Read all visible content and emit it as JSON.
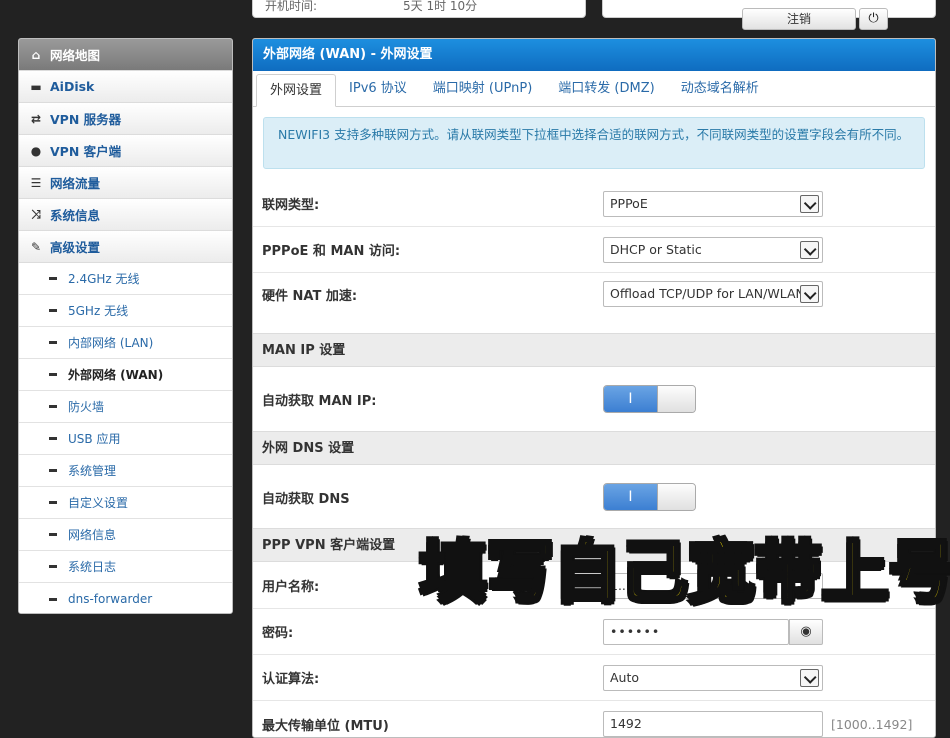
{
  "top": {
    "uptime_label": "开机时间:",
    "uptime_value": "5天 1时 10分",
    "logout_label": "注销",
    "power_icon": "power-icon"
  },
  "sidebar": {
    "items": [
      {
        "label": "网络地图",
        "icon": "home-icon"
      },
      {
        "label": "AiDisk",
        "icon": "disk-icon"
      },
      {
        "label": "VPN 服务器",
        "icon": "retweet-icon"
      },
      {
        "label": "VPN 客户端",
        "icon": "globe-icon"
      },
      {
        "label": "网络流量",
        "icon": "list-icon"
      },
      {
        "label": "系统信息",
        "icon": "shuffle-icon"
      },
      {
        "label": "高级设置",
        "icon": "wrench-icon"
      }
    ],
    "subitems": [
      {
        "label": "2.4GHz 无线"
      },
      {
        "label": "5GHz 无线"
      },
      {
        "label": "内部网络 (LAN)"
      },
      {
        "label": "外部网络 (WAN)"
      },
      {
        "label": "防火墙"
      },
      {
        "label": "USB 应用"
      },
      {
        "label": "系统管理"
      },
      {
        "label": "自定义设置"
      },
      {
        "label": "网络信息"
      },
      {
        "label": "系统日志"
      },
      {
        "label": "dns-forwarder"
      }
    ]
  },
  "main": {
    "title": "外部网络 (WAN) - 外网设置",
    "tabs": [
      "外网设置",
      "IPv6 协议",
      "端口映射 (UPnP)",
      "端口转发 (DMZ)",
      "动态域名解析"
    ],
    "info": "NEWIFI3 支持多种联网方式。请从联网类型下拉框中选择合适的联网方式，不同联网类型的设置字段会有所不同。",
    "fields": {
      "wan_type_label": "联网类型:",
      "wan_type_value": "PPPoE",
      "man_access_label": "PPPoE 和 MAN 访问:",
      "man_access_value": "DHCP or Static",
      "hw_nat_label": "硬件 NAT 加速:",
      "hw_nat_value": "Offload TCP/UDP for LAN/WLAN",
      "man_ip_section": "MAN IP 设置",
      "auto_man_ip_label": "自动获取 MAN IP:",
      "auto_man_ip_on": "I",
      "dns_section": "外网 DNS 设置",
      "auto_dns_label": "自动获取 DNS",
      "auto_dns_on": "I",
      "ppp_section": "PPP VPN 客户端设置",
      "username_label": "用户名称:",
      "username_value": "1...",
      "password_label": "密码:",
      "password_value": "••••••",
      "auth_label": "认证算法:",
      "auth_value": "Auto",
      "mtu_label": "最大传输单位 (MTU)",
      "mtu_value": "1492",
      "mtu_hint": "[1000..1492]"
    }
  },
  "overlay": {
    "caption": "填写自己宽带上号"
  }
}
